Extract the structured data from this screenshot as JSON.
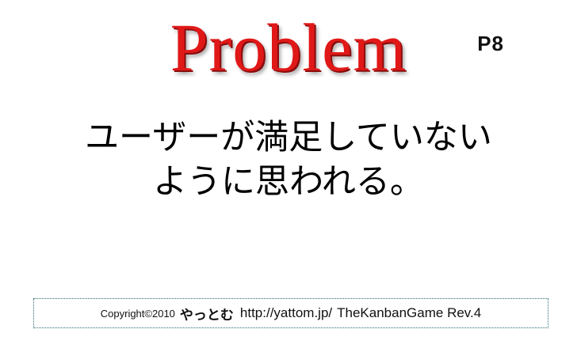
{
  "slide": {
    "title": "Problem",
    "page_number": "P8",
    "main_text": {
      "line1": "ユーザーが満足していない",
      "line2": "ように思われる。"
    },
    "footer": {
      "copyright": "Copyright©2010",
      "author": "やっとむ",
      "url": "http://yattom.jp/",
      "game": "TheKanbanGame Rev.4"
    }
  },
  "colors": {
    "title": "#e01818",
    "text": "#000000",
    "footer_border": "#2b6b74",
    "background": "#ffffff"
  }
}
